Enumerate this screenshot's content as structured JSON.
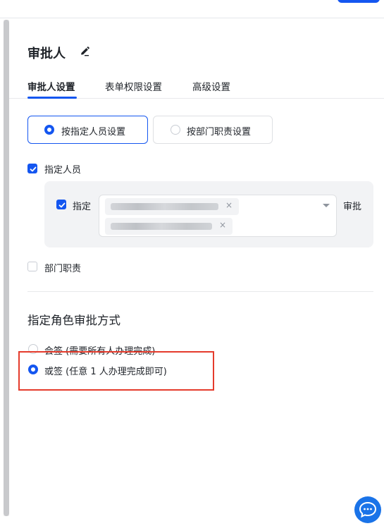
{
  "panel": {
    "title": "审批人"
  },
  "tabs": [
    {
      "label": "审批人设置",
      "active": true
    },
    {
      "label": "表单权限设置",
      "active": false
    },
    {
      "label": "高级设置",
      "active": false
    }
  ],
  "mode_options": [
    {
      "label": "按指定人员设置",
      "selected": true
    },
    {
      "label": "按部门职责设置",
      "selected": false
    }
  ],
  "assignee": {
    "checkbox_label": "指定人员",
    "checked": true,
    "inner_checkbox_label": "指定",
    "inner_checked": true,
    "suffix": "审批",
    "tags": [
      {
        "remove": "×"
      },
      {
        "remove": "×"
      }
    ]
  },
  "department_duty": {
    "checkbox_label": "部门职责",
    "checked": false
  },
  "approval_method": {
    "section_title": "指定角色审批方式",
    "options": [
      {
        "label": "会签 (需要所有人办理完成)",
        "selected": false
      },
      {
        "label": "或签 (任意 1 人办理完成即可)",
        "selected": true
      }
    ]
  },
  "colors": {
    "accent": "#1456f0",
    "highlight_border": "#e53b2c"
  },
  "icons": {
    "edit": "pencil-icon",
    "chat": "chat-bubble-icon",
    "check": "check-icon",
    "dropdown": "caret-down-icon"
  }
}
